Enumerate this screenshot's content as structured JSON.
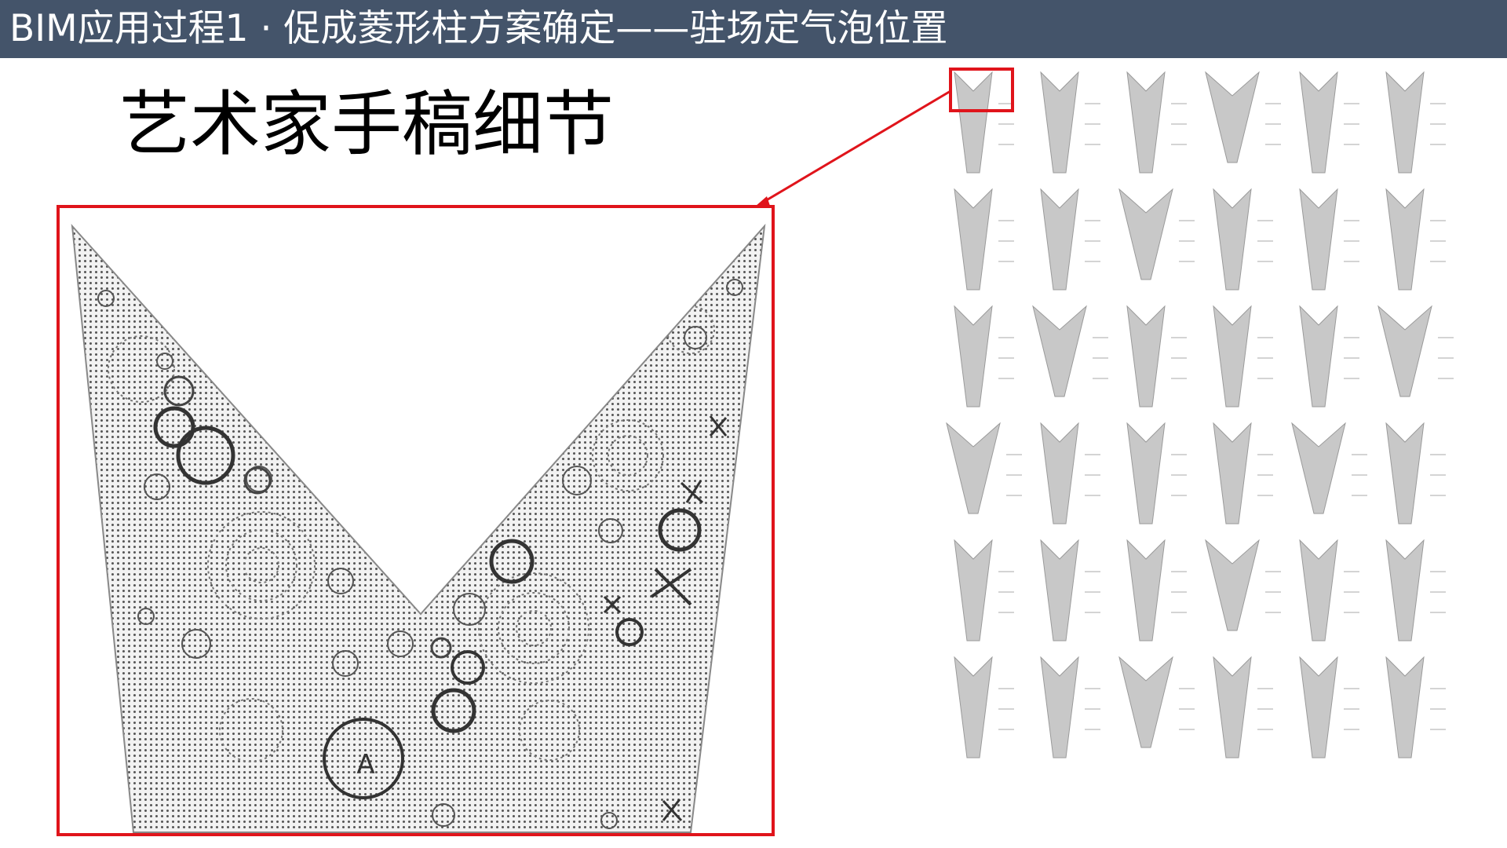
{
  "slide": {
    "header_title": "BIM应用过程1 · 促成菱形柱方案确定——驻场定气泡位置",
    "subtitle": "艺术家手稿细节",
    "colors": {
      "header_bg": "#44546a",
      "header_text": "#ffffff",
      "highlight": "#e0141b",
      "panel_fill": "#c8c8c8"
    }
  },
  "detail_view": {
    "label_marker": "A",
    "description": "Enlarged V-shaped sketch panel with dotted texture, bubble circles and X marks"
  },
  "thumbnail_grid": {
    "rows": 6,
    "columns": 6
  }
}
